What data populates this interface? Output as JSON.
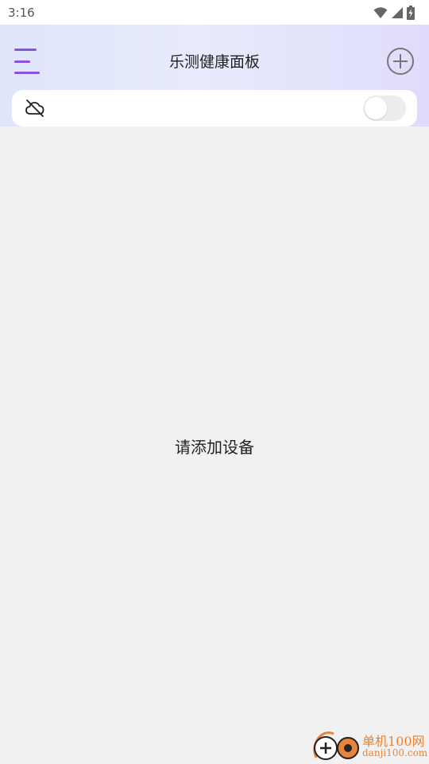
{
  "status_bar": {
    "time": "3:16"
  },
  "header": {
    "title": "乐测健康面板"
  },
  "cloud_sync": {
    "enabled": false
  },
  "main": {
    "empty_message": "请添加设备"
  },
  "watermark": {
    "title": "单机100网",
    "url": "danji100.com"
  },
  "colors": {
    "accent": "#8b50e6",
    "background": "#f1f1f1",
    "watermark": "#e8843a"
  }
}
